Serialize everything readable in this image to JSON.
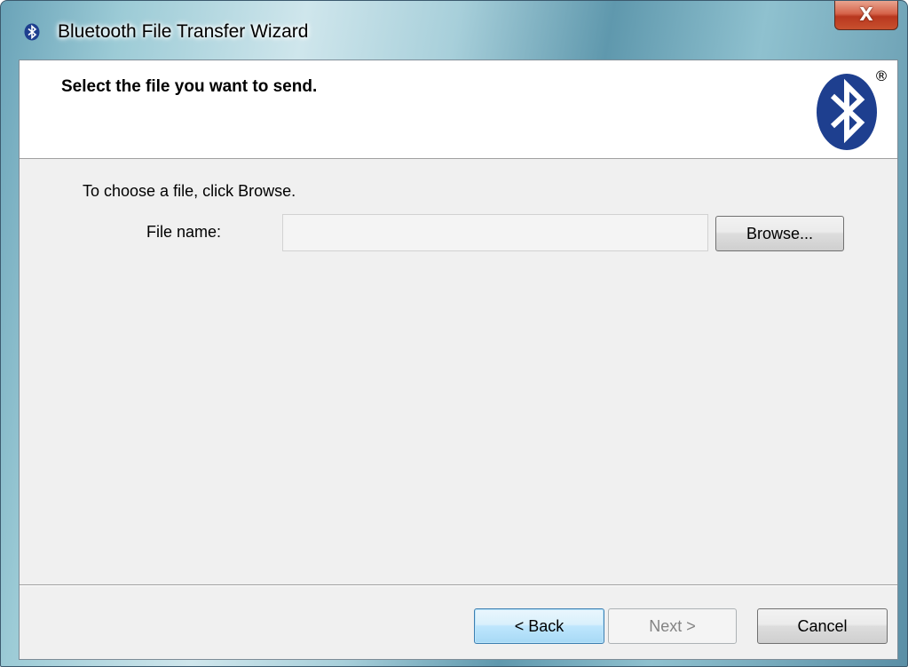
{
  "window": {
    "title": "Bluetooth File Transfer Wizard",
    "close_label": "X",
    "icon": "bluetooth-icon",
    "close_color": "#c8452a"
  },
  "header": {
    "title": "Select the file you want to send.",
    "logo": "bluetooth-logo",
    "registered_mark": "®",
    "logo_color": "#1e3f8f"
  },
  "body": {
    "instruction": "To choose a file, click Browse.",
    "file_label": "File name:",
    "file_value": "",
    "browse_label": "Browse..."
  },
  "footer": {
    "back_label": "< Back",
    "next_label": "Next >",
    "cancel_label": "Cancel"
  }
}
